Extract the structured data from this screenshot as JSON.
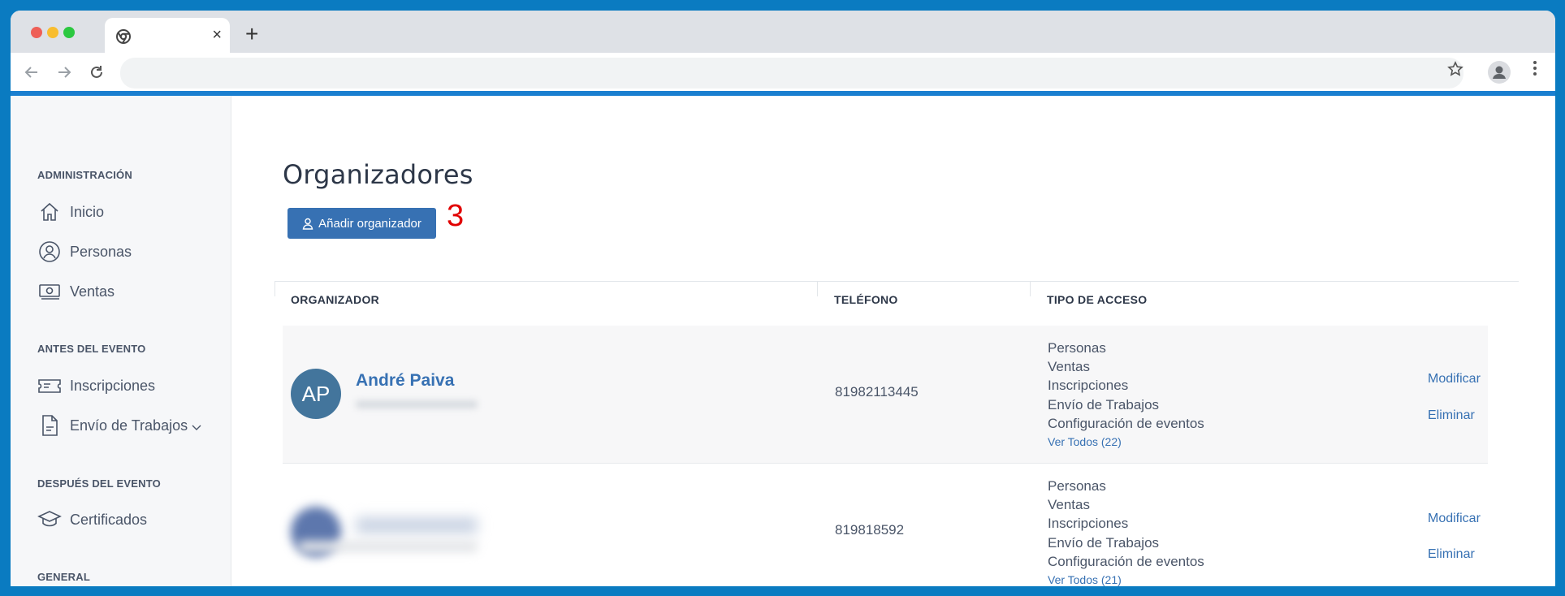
{
  "browser": {
    "tab_close": "×",
    "new_tab": "+",
    "address": ""
  },
  "sidebar": {
    "sections": [
      {
        "title": "ADMINISTRACIÓN",
        "items": [
          {
            "label": "Inicio",
            "icon": "home-icon"
          },
          {
            "label": "Personas",
            "icon": "user-circle-icon"
          },
          {
            "label": "Ventas",
            "icon": "money-icon"
          }
        ]
      },
      {
        "title": "ANTES DEL EVENTO",
        "items": [
          {
            "label": "Inscripciones",
            "icon": "ticket-icon"
          },
          {
            "label": "Envío de Trabajos",
            "icon": "document-icon"
          }
        ]
      },
      {
        "title": "DESPUÉS DEL EVENTO",
        "items": [
          {
            "label": "Certificados",
            "icon": "graduation-cap-icon"
          }
        ]
      },
      {
        "title": "GENERAL",
        "items": []
      }
    ]
  },
  "main": {
    "title": "Organizadores",
    "add_button_label": "Añadir organizador",
    "annotation": "3",
    "table": {
      "headers": [
        "ORGANIZADOR",
        "TELÉFONO",
        "TIPO DE ACCESO"
      ],
      "rows": [
        {
          "initials": "AP",
          "name": "André Paiva",
          "phone": "81982113445",
          "access": [
            "Personas",
            "Ventas",
            "Inscripciones",
            "Envío de Trabajos",
            "Configuración de eventos"
          ],
          "ver_todos": "Ver Todos (22)",
          "modify": "Modificar",
          "delete": "Eliminar"
        },
        {
          "initials": "",
          "name": "",
          "phone": "819818592",
          "access": [
            "Personas",
            "Ventas",
            "Inscripciones",
            "Envío de Trabajos",
            "Configuración de eventos"
          ],
          "ver_todos": "Ver Todos (21)",
          "modify": "Modificar",
          "delete": "Eliminar"
        }
      ]
    }
  },
  "colors": {
    "frame": "#0a7bc1",
    "accent": "#3771b3",
    "avatar": "#43759c",
    "annotation": "#e10000"
  }
}
